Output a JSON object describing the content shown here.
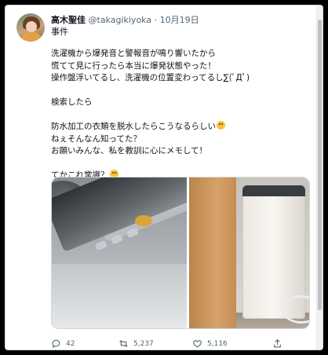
{
  "tweet": {
    "author": {
      "name": "高木聖佳",
      "handle": "@takagikiyoka",
      "separator": "·",
      "date": "10月19日"
    },
    "category": "事件",
    "lines": [
      "洗濯機から爆発音と警報音が鳴り響いたから",
      "慌てて見に行ったら本当に爆発状態やった！",
      "操作盤浮いてるし、洗濯機の位置変わってるし∑(ﾟДﾟ)",
      "",
      "検索したら",
      "",
      "防水加工の衣類を脱水したらこうなるらしい",
      "ねぇそんなん知ってた？",
      "お願いみんな、私を教訓に心にメモして！",
      "",
      "てかこれ常識？"
    ],
    "emoji_after_line_index": [
      6,
      10
    ],
    "emoji_name": "grinning-sweat-emoji",
    "media": {
      "left_photo": "washing-machine-control-panel-lifted-photo",
      "right_photo": "washing-machine-shifted-position-photo"
    },
    "actions": {
      "replies": "42",
      "retweets": "5,237",
      "likes": "5,116"
    },
    "icons": {
      "reply": "reply-icon",
      "retweet": "retweet-icon",
      "like": "heart-icon",
      "share": "share-icon"
    },
    "colors": {
      "text": "#0f1419",
      "secondary": "#536471",
      "border": "#cfd9de"
    }
  }
}
